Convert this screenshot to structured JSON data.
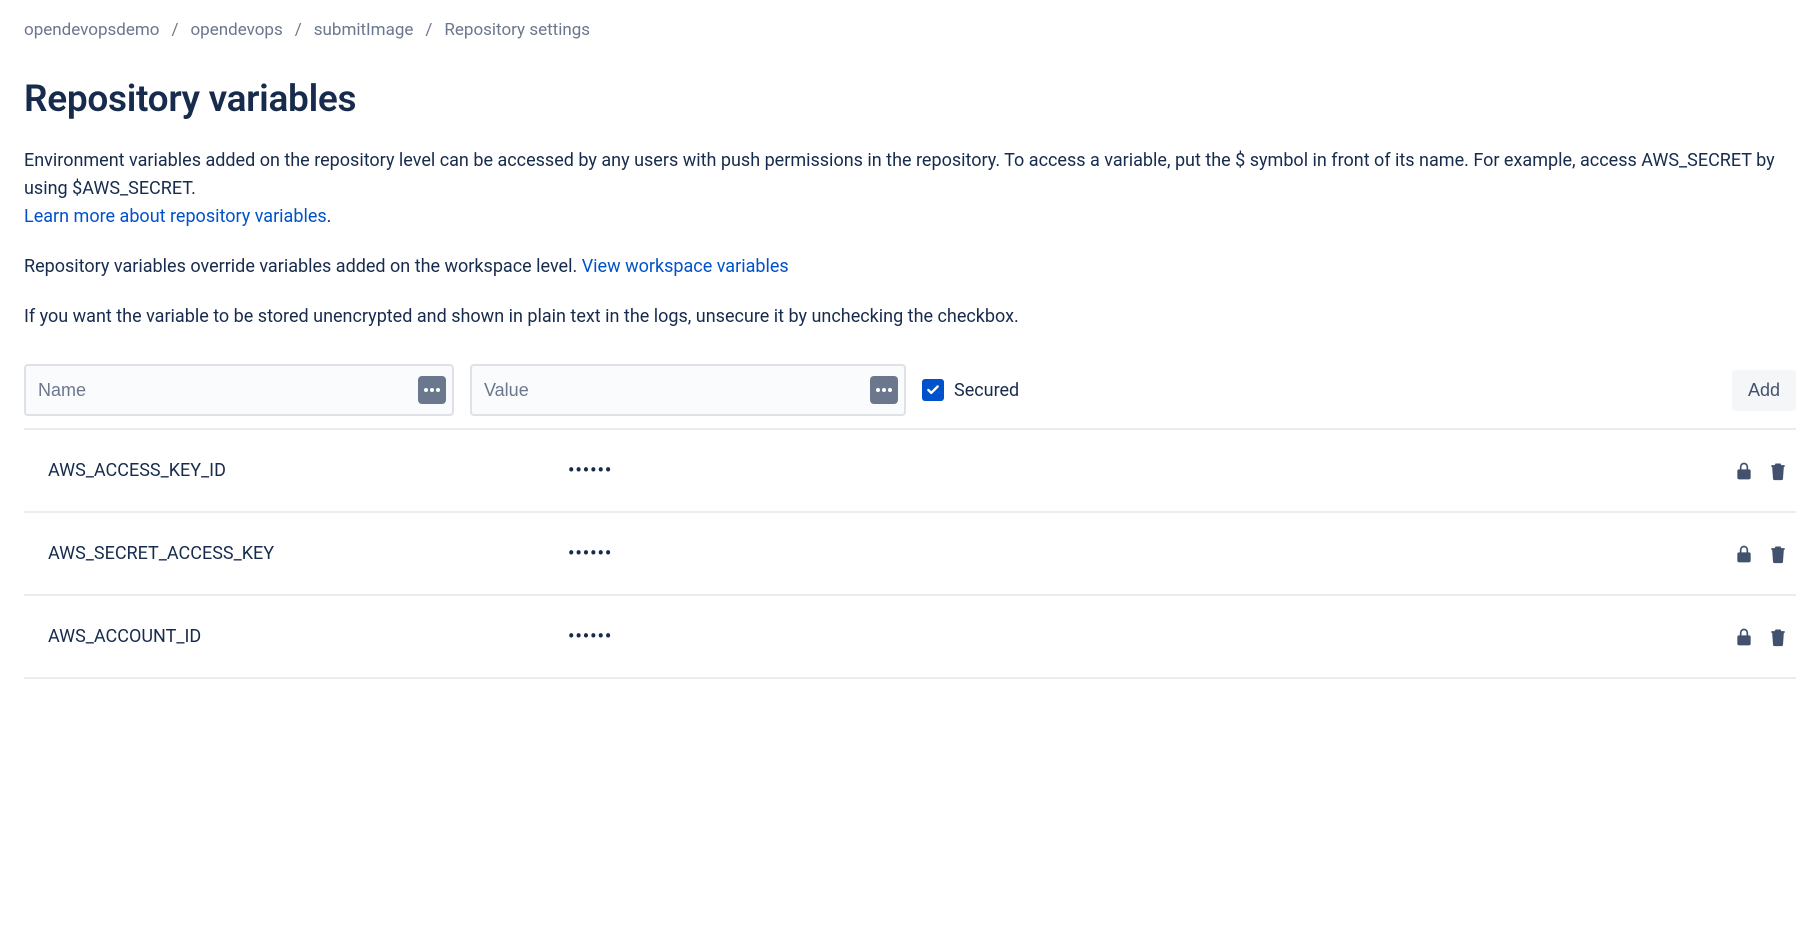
{
  "breadcrumb": {
    "items": [
      "opendevopsdemo",
      "opendevops",
      "submitImage",
      "Repository settings"
    ]
  },
  "page": {
    "title": "Repository variables",
    "desc1": "Environment variables added on the repository level can be accessed by any users with push permissions in the repository. To access a variable, put the $ symbol in front of its name. For example, access AWS_SECRET by using $AWS_SECRET.",
    "learn_more": "Learn more about repository variables",
    "desc2_prefix": "Repository variables override variables added on the workspace level. ",
    "view_workspace": "View workspace variables",
    "desc3": "If you want the variable to be stored unencrypted and shown in plain text in the logs, unsecure it by unchecking the checkbox."
  },
  "form": {
    "name_placeholder": "Name",
    "value_placeholder": "Value",
    "secured_label": "Secured",
    "add_label": "Add"
  },
  "variables": [
    {
      "name": "AWS_ACCESS_KEY_ID",
      "value": "••••••"
    },
    {
      "name": "AWS_SECRET_ACCESS_KEY",
      "value": "••••••"
    },
    {
      "name": "AWS_ACCOUNT_ID",
      "value": "••••••"
    }
  ]
}
